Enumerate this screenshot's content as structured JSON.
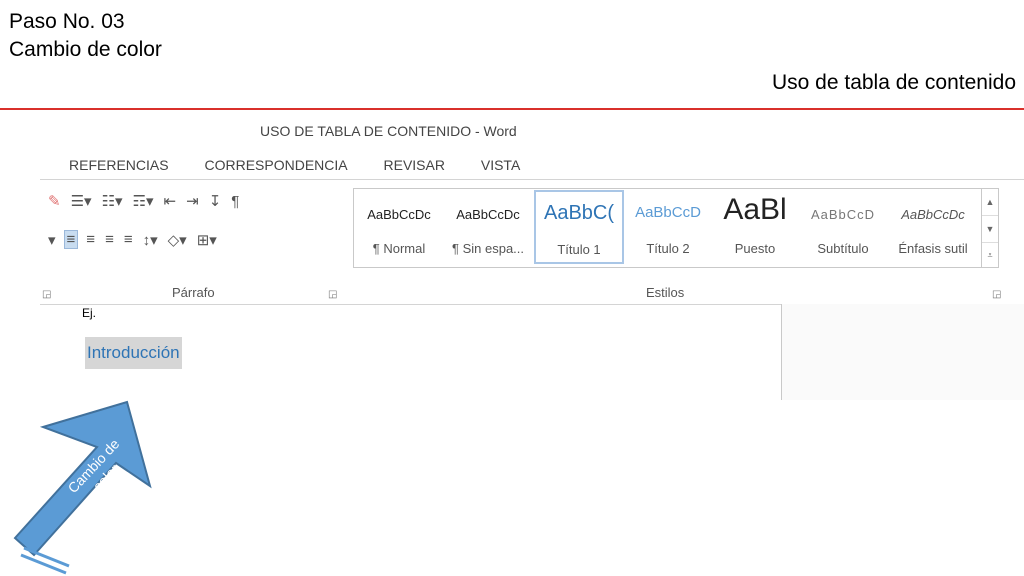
{
  "slide": {
    "title_line1": "Paso No. 03",
    "title_line2": "Cambio de color",
    "subtitle": "Uso de tabla de contenido",
    "accent_color": "#d9302b"
  },
  "word": {
    "doc_title": "USO DE TABLA DE CONTENIDO - Word",
    "tabs": [
      "REFERENCIAS",
      "CORRESPONDENCIA",
      "REVISAR",
      "VISTA"
    ],
    "paragraph_group_label": "Párrafo",
    "styles_group_label": "Estilos",
    "styles": [
      {
        "sample": "AaBbCcDc",
        "name": "¶ Normal"
      },
      {
        "sample": "AaBbCcDc",
        "name": "¶ Sin espa..."
      },
      {
        "sample": "AaBbC(",
        "name": "Título 1"
      },
      {
        "sample": "AaBbCcD",
        "name": "Título 2"
      },
      {
        "sample": "AaBl",
        "name": "Puesto"
      },
      {
        "sample": "AaBbCcD",
        "name": "Subtítulo"
      },
      {
        "sample": "AaBbCcDc",
        "name": "Énfasis sutil"
      }
    ],
    "document": {
      "ej_text": "Ej.",
      "intro_text": "Introducción",
      "intro_color": "#2e74b5"
    }
  },
  "callout": {
    "label_line1": "Cambio de",
    "label_line2": "color",
    "arrow_color": "#5b9bd5"
  }
}
